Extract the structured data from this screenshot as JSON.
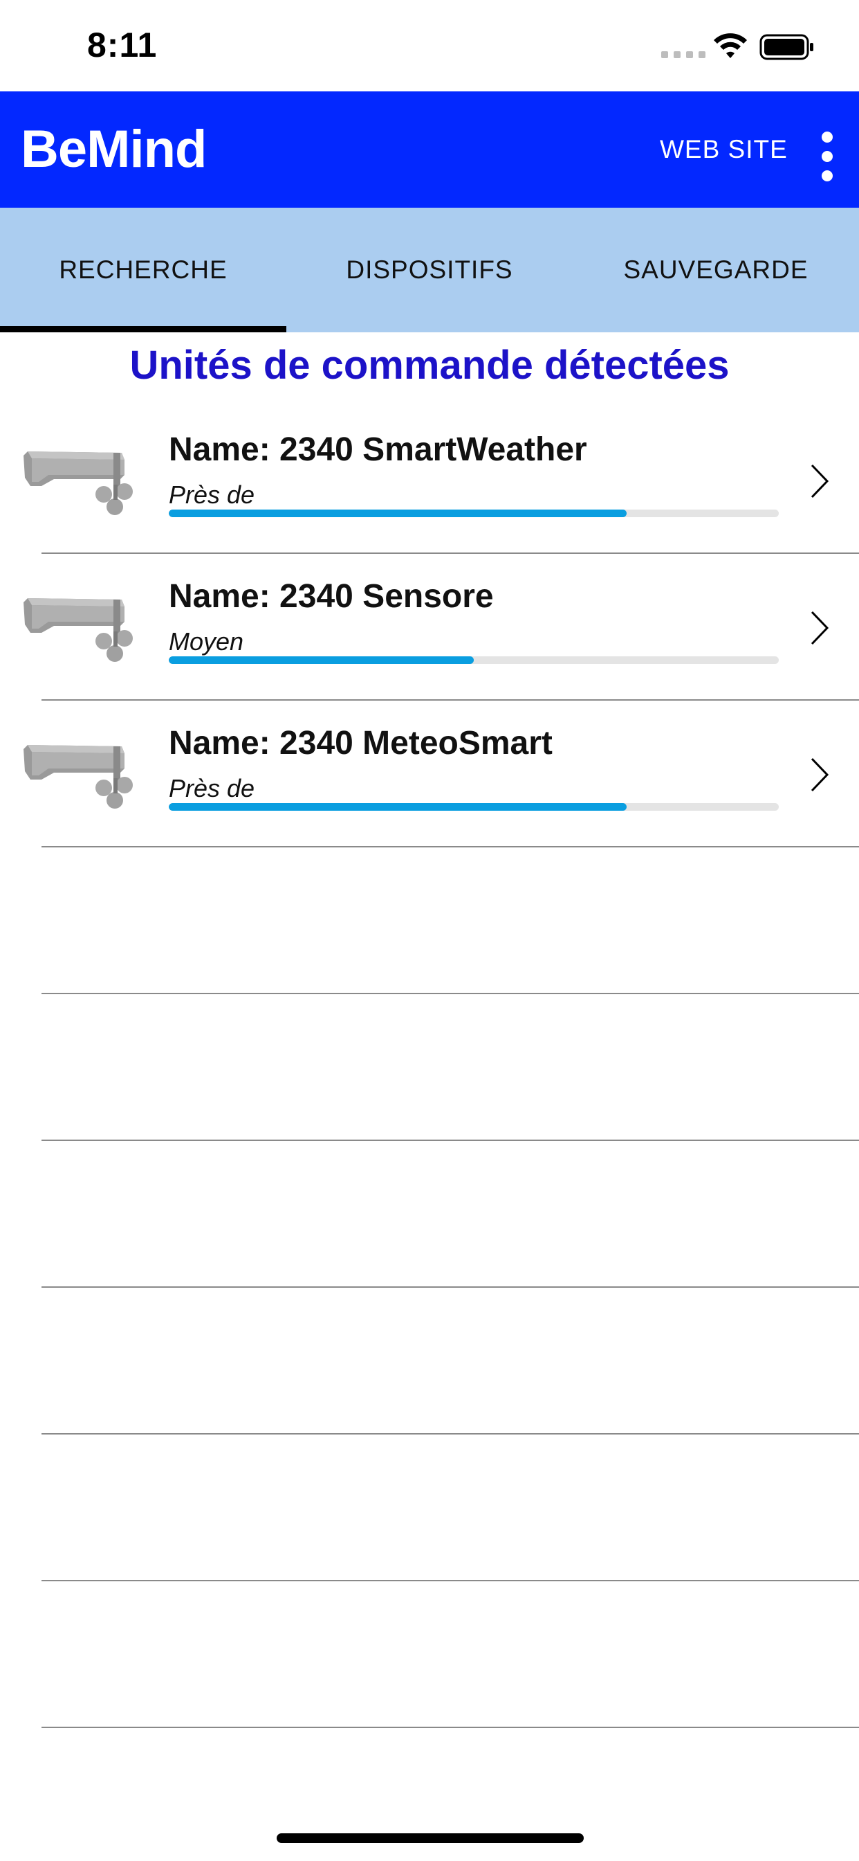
{
  "status_bar": {
    "time": "8:11",
    "icons": [
      "cellular-signal-icon",
      "wifi-icon",
      "battery-icon"
    ]
  },
  "app_bar": {
    "title": "BeMind",
    "web_site_label": "WEB SITE",
    "more_icon": "more-vertical-icon",
    "background_color": "#0328ff"
  },
  "tabs": {
    "items": [
      {
        "label": "RECHERCHE",
        "selected": true
      },
      {
        "label": "DISPOSITIFS",
        "selected": false
      },
      {
        "label": "SAUVEGARDE",
        "selected": false
      }
    ],
    "background_color": "#abcdf0"
  },
  "main": {
    "title": "Unités de commande détectées",
    "title_color": "#1c12c8",
    "devices": [
      {
        "name": "Name: 2340 SmartWeather",
        "proximity": "Près de",
        "signal": 0.75
      },
      {
        "name": "Name: 2340 Sensore",
        "proximity": "Moyen",
        "signal": 0.5
      },
      {
        "name": "Name: 2340 MeteoSmart",
        "proximity": "Près de",
        "signal": 0.75
      }
    ],
    "signal_bar_color": "#0a9ee0",
    "device_icon": "weather-station-icon",
    "row_action_icon": "chevron-right-icon"
  }
}
